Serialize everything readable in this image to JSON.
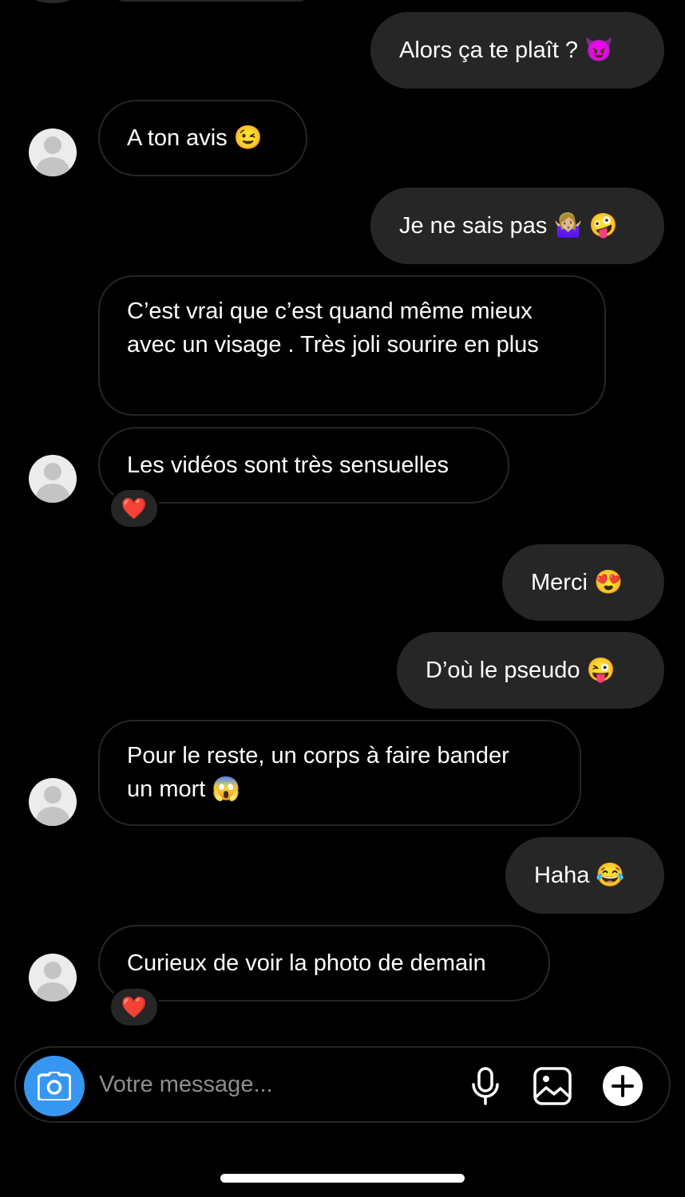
{
  "messages": [
    {
      "dir": "out",
      "text": "Alors ça te plaît ? 😈"
    },
    {
      "dir": "in",
      "text": "A ton avis 😉"
    },
    {
      "dir": "out",
      "text": "Je ne sais pas 🤷🏼‍♀️ 🤪"
    },
    {
      "dir": "in",
      "line1": "C’est vrai que c’est quand même mieux",
      "line2": "avec un visage . Très joli sourire en plus"
    },
    {
      "dir": "in",
      "text": "Les vidéos sont très sensuelles",
      "reaction": "❤️"
    },
    {
      "dir": "out",
      "text": "Merci 😍"
    },
    {
      "dir": "out",
      "text": "D’où le pseudo 😜"
    },
    {
      "dir": "in",
      "line1": "Pour le reste, un corps à faire bander",
      "line2": "un mort 😱"
    },
    {
      "dir": "out",
      "text": "Haha 😂"
    },
    {
      "dir": "in",
      "text": "Curieux de voir la photo de demain",
      "reaction": "❤️"
    }
  ],
  "composer": {
    "placeholder": "Votre message...",
    "icons": [
      "camera-icon",
      "microphone-icon",
      "gallery-icon",
      "plus-icon"
    ],
    "camera_color": "#3797f0"
  },
  "theme": {
    "background": "#000000",
    "bubble_out": "#262626",
    "bubble_in_border": "#262626"
  }
}
